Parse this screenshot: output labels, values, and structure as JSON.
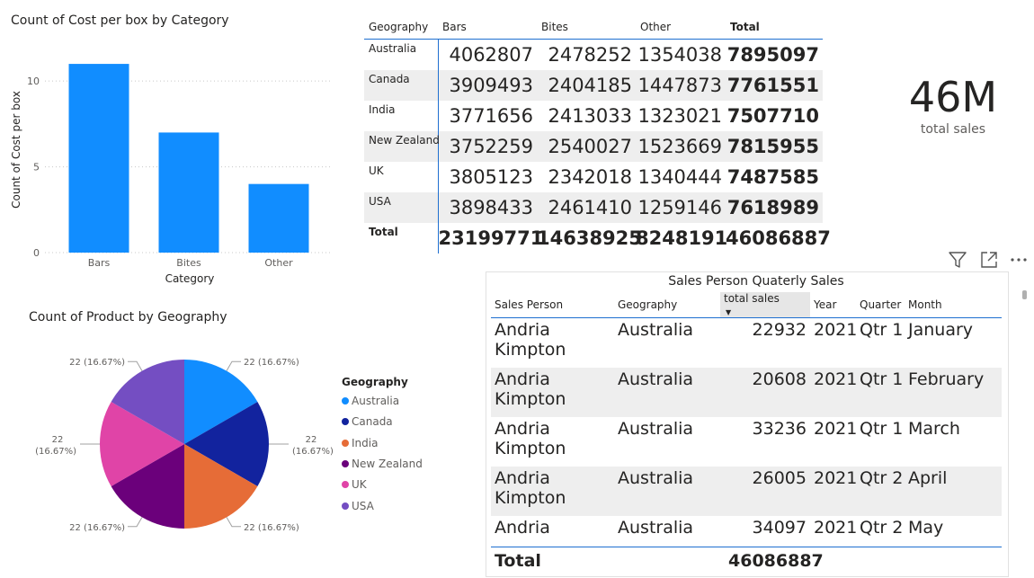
{
  "bar_visual": {
    "title": "Count of Cost per box by Category",
    "chart_data": {
      "type": "bar",
      "title": "Count of Cost per box by Category",
      "xlabel": "Category",
      "ylabel": "Count of Cost per box",
      "categories": [
        "Bars",
        "Bites",
        "Other"
      ],
      "values": [
        11,
        7,
        4
      ],
      "ylim": [
        0,
        12
      ],
      "yticks": [
        "0",
        "5",
        "10"
      ],
      "grid": true,
      "color": "#118dff"
    }
  },
  "pie_visual": {
    "title": "Count of Product by Geography",
    "chart_data": {
      "type": "pie",
      "title": "Count of Product by Geography",
      "legend_title": "Geography",
      "labels": [
        "Australia",
        "Canada",
        "India",
        "New Zealand",
        "UK",
        "USA"
      ],
      "values": [
        22,
        22,
        22,
        22,
        22,
        22
      ],
      "colors": [
        "#118dff",
        "#12239e",
        "#e66c37",
        "#6b007b",
        "#e044a7",
        "#744ec2"
      ],
      "data_labels": [
        "22 (16.67%)",
        "22 (16.67%)",
        "22 (16.67%)",
        "22 (16.67%)",
        "22 (16.67%)",
        "22 (16.67%)"
      ],
      "legend_position": "right"
    }
  },
  "matrix": {
    "headers": [
      "Geography",
      "Bars",
      "Bites",
      "Other",
      "Total"
    ],
    "rows": [
      {
        "geo": "Australia",
        "bars": "4062807",
        "bites": "2478252",
        "other": "1354038",
        "total": "7895097"
      },
      {
        "geo": "Canada",
        "bars": "3909493",
        "bites": "2404185",
        "other": "1447873",
        "total": "7761551"
      },
      {
        "geo": "India",
        "bars": "3771656",
        "bites": "2413033",
        "other": "1323021",
        "total": "7507710"
      },
      {
        "geo": "New Zealand",
        "bars": "3752259",
        "bites": "2540027",
        "other": "1523669",
        "total": "7815955"
      },
      {
        "geo": "UK",
        "bars": "3805123",
        "bites": "2342018",
        "other": "1340444",
        "total": "7487585"
      },
      {
        "geo": "USA",
        "bars": "3898433",
        "bites": "2461410",
        "other": "1259146",
        "total": "7618989"
      }
    ],
    "total_row": {
      "geo": "Total",
      "bars": "23199771",
      "bites": "14638925",
      "other": "8248191",
      "total": "46086887"
    }
  },
  "card": {
    "value": "46M",
    "label": "total sales"
  },
  "visual_header_icons": [
    "filter-icon",
    "focus-mode-icon",
    "more-options-icon"
  ],
  "sales_table": {
    "title": "Sales Person Quaterly Sales",
    "headers": [
      "Sales Person",
      "Geography",
      "total sales",
      "Year",
      "Quarter",
      "Month"
    ],
    "sorted_column": "total sales",
    "rows": [
      {
        "person": "Andria Kimpton",
        "geo": "Australia",
        "sales": "22932",
        "year": "2021",
        "quarter": "Qtr 1",
        "month": "January"
      },
      {
        "person": "Andria Kimpton",
        "geo": "Australia",
        "sales": "20608",
        "year": "2021",
        "quarter": "Qtr 1",
        "month": "February"
      },
      {
        "person": "Andria Kimpton",
        "geo": "Australia",
        "sales": "33236",
        "year": "2021",
        "quarter": "Qtr 1",
        "month": "March"
      },
      {
        "person": "Andria Kimpton",
        "geo": "Australia",
        "sales": "26005",
        "year": "2021",
        "quarter": "Qtr 2",
        "month": "April"
      },
      {
        "person": "Andria",
        "geo": "Australia",
        "sales": "34097",
        "year": "2021",
        "quarter": "Qtr 2",
        "month": "May"
      }
    ],
    "total_label": "Total",
    "total_value": "46086887"
  }
}
